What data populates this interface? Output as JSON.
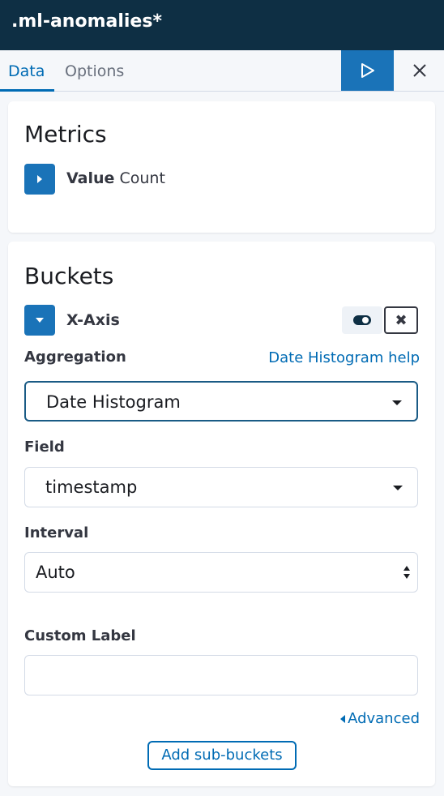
{
  "header": {
    "title": ".ml-anomalies*"
  },
  "tabs": [
    {
      "label": "Data",
      "active": true
    },
    {
      "label": "Options",
      "active": false
    }
  ],
  "toolbar": {
    "apply_icon": "play-icon",
    "close_icon": "close-icon"
  },
  "metrics": {
    "title": "Metrics",
    "items": [
      {
        "label_bold": "Value",
        "label_rest": "Count",
        "icon": "chevron-right-icon"
      }
    ]
  },
  "buckets": {
    "title": "Buckets",
    "agg": {
      "label": "X-Axis",
      "icon": "chevron-down-icon"
    },
    "aggregation": {
      "label": "Aggregation",
      "help": "Date Histogram help",
      "value": "Date Histogram"
    },
    "field": {
      "label": "Field",
      "value": "timestamp"
    },
    "interval": {
      "label": "Interval",
      "value": "Auto"
    },
    "custom_label": {
      "label": "Custom Label",
      "value": "",
      "placeholder": ""
    },
    "advanced": "Advanced",
    "add_sub_buckets": "Add sub-buckets"
  },
  "colors": {
    "header_bg": "#0e2f44",
    "accent": "#006bb4",
    "button_blue": "#1a73b8"
  }
}
